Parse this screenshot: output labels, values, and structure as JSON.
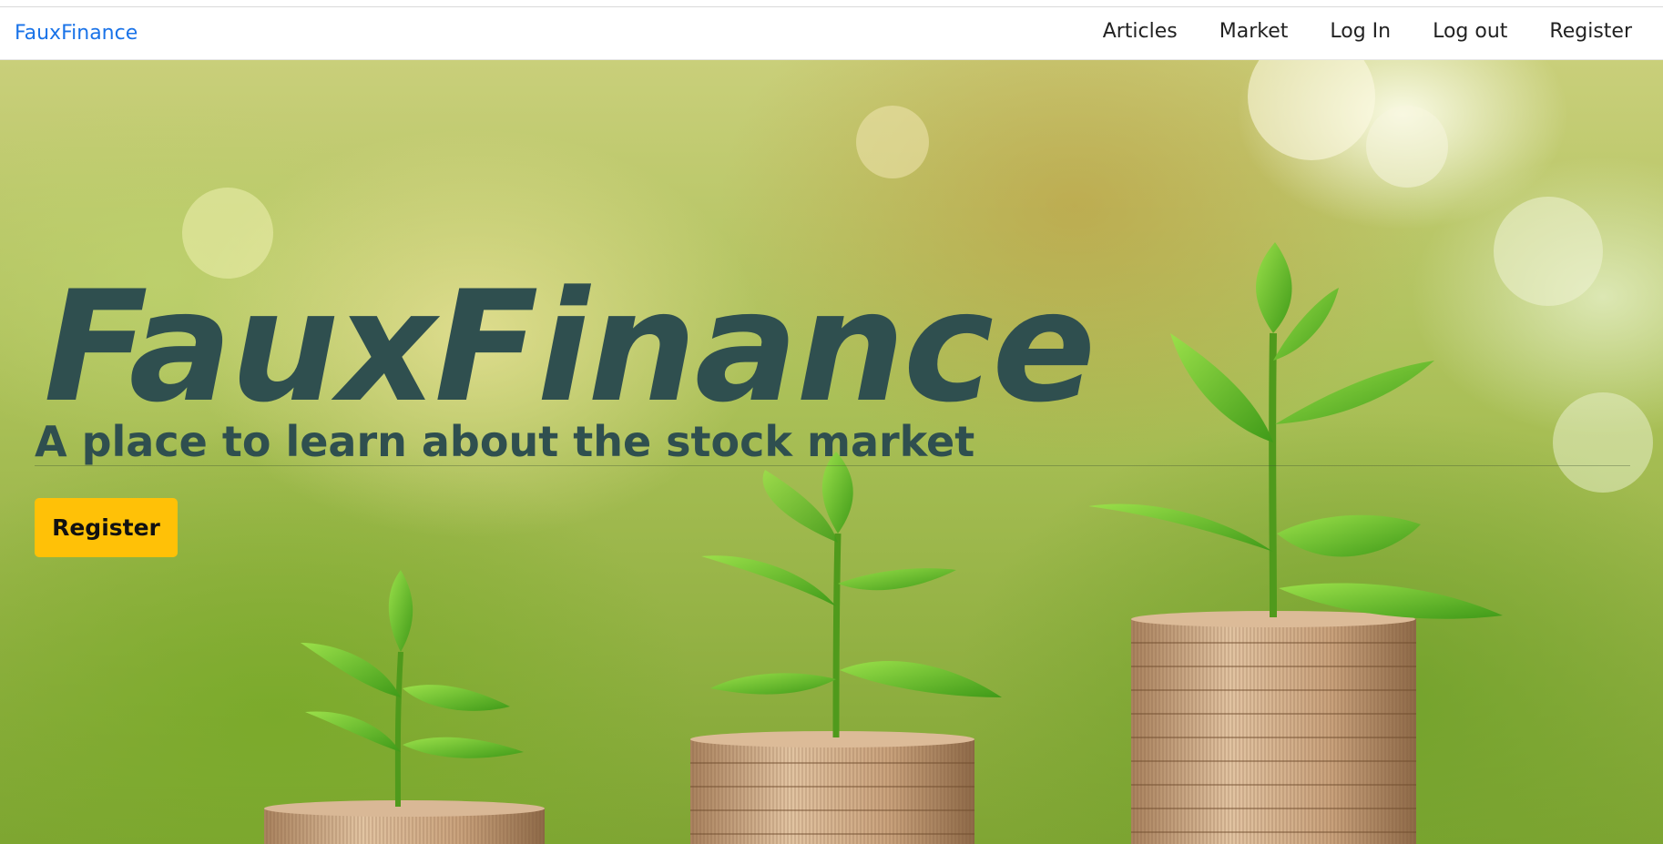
{
  "navbar": {
    "brand": "FauxFinance",
    "links": [
      {
        "label": "Articles"
      },
      {
        "label": "Market"
      },
      {
        "label": "Log In"
      },
      {
        "label": "Log out"
      },
      {
        "label": "Register"
      }
    ]
  },
  "hero": {
    "title": "FauxFinance",
    "subtitle": "A place to learn about the stock market",
    "button_label": "Register",
    "background_image": "plant-sprouts-on-coin-stacks"
  },
  "colors": {
    "brand_link": "#1a73e8",
    "hero_text": "#2f4f4f",
    "button_bg": "#ffc107"
  }
}
